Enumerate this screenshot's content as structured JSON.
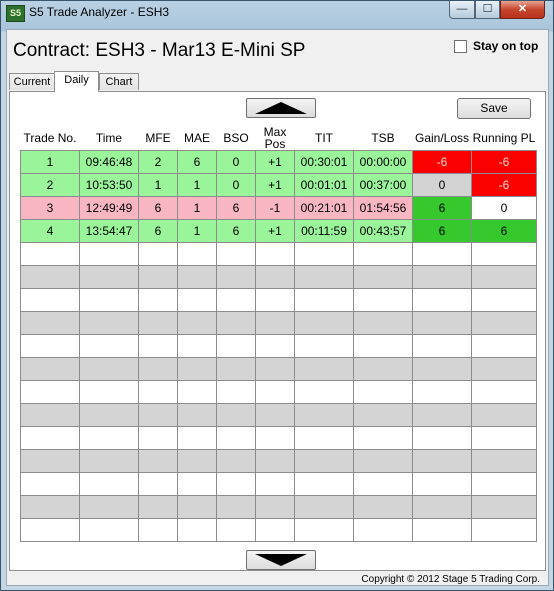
{
  "window": {
    "title": "S5 Trade Analyzer - ESH3",
    "app_icon_text": "S5",
    "minimize_glyph": "—",
    "maximize_glyph": "☐",
    "close_glyph": "✕"
  },
  "header": {
    "contract_label": "Contract: ESH3 - Mar13 E-Mini SP",
    "stay_on_top_label": "Stay on top",
    "stay_on_top_checked": false
  },
  "tabs": [
    {
      "label": "Current",
      "active": false
    },
    {
      "label": "Daily",
      "active": true
    },
    {
      "label": "Chart",
      "active": false
    }
  ],
  "toolbar": {
    "save_label": "Save",
    "scroll_up_icon": "up-triangle-icon",
    "scroll_down_icon": "down-triangle-icon"
  },
  "table": {
    "columns": [
      "Trade No.",
      "Time",
      "MFE",
      "MAE",
      "BSO",
      "Max Pos",
      "TIT",
      "TSB",
      "Gain/Loss",
      "Running PL"
    ],
    "rows": [
      {
        "cells": [
          "1",
          "09:46:48",
          "2",
          "6",
          "0",
          "+1",
          "00:30:01",
          "00:00:00",
          "-6",
          "-6"
        ],
        "row_color": "green",
        "gain_color": "red",
        "running_color": "red"
      },
      {
        "cells": [
          "2",
          "10:53:50",
          "1",
          "1",
          "0",
          "+1",
          "00:01:01",
          "00:37:00",
          "0",
          "-6"
        ],
        "row_color": "green",
        "gain_color": "gray",
        "running_color": "red"
      },
      {
        "cells": [
          "3",
          "12:49:49",
          "6",
          "1",
          "6",
          "-1",
          "00:21:01",
          "01:54:56",
          "6",
          "0"
        ],
        "row_color": "pink",
        "gain_color": "green",
        "running_color": "white"
      },
      {
        "cells": [
          "4",
          "13:54:47",
          "6",
          "1",
          "6",
          "+1",
          "00:11:59",
          "00:43:57",
          "6",
          "6"
        ],
        "row_color": "green",
        "gain_color": "green",
        "running_color": "green"
      }
    ],
    "empty_rows": 13
  },
  "colors": {
    "row_green": "#9af49a",
    "row_pink": "#f7b6c1",
    "loss_red": "#fb0000",
    "gain_green": "#35c92e",
    "neutral_gray": "#d2d2d2"
  },
  "footer": {
    "copyright": "Copyright © 2012 Stage 5 Trading Corp."
  }
}
